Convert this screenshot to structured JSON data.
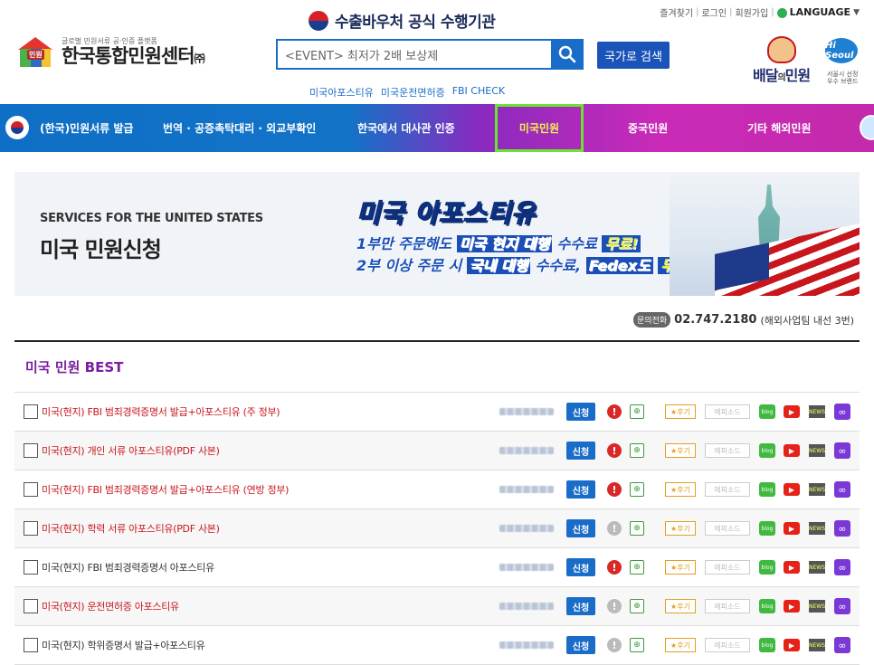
{
  "util": {
    "bookmark": "즐겨찾기",
    "login": "로그인",
    "signup": "회원가입",
    "language": "LANGUAGE"
  },
  "header": {
    "top_banner": "수출바우처 공식 수행기관",
    "logo_sub": "글로벌 민원서류 공·인증 플랫폼",
    "logo_main": "한국통합민원센터",
    "logo_suffix": "㈜",
    "logo_badge": "민원",
    "search_placeholder": "<EVENT> 최저가 2배 보상제",
    "country_search_label": "국가로 검색",
    "quick_links": [
      "미국아포스티유",
      "미국운전면허증",
      "FBI CHECK"
    ],
    "partner_title_a": "배달",
    "partner_title_b": "의",
    "partner_title_c": "민원",
    "partner_hi": "Hi Seoul",
    "partner_sub": "서울시 선정 우수 브랜드"
  },
  "nav": {
    "items": [
      "(한국)민원서류 발급",
      "번역 · 공증촉탁대리 · 외교부확인",
      "한국에서 대사관 인증",
      "미국민원",
      "중국민원",
      "기타 해외민원"
    ]
  },
  "hero": {
    "en_title": "SERVICES FOR THE UNITED STATES",
    "ko_title": "미국 민원신청",
    "apostille": "미국 아포스티유",
    "line1_a": "1부만 주문해도",
    "line1_b": "미국 현지 대행",
    "line1_c": "수수료",
    "line1_d": "무료!",
    "line2_a": "2부 이상 주문 시",
    "line2_b": "국내 대행",
    "line2_c": "수수료,",
    "line2_d": "Fedex도",
    "line2_e": "무료!"
  },
  "contact": {
    "tag": "문의전화",
    "phone": "02.747.2180",
    "ext": "(해외사업팀 내선 3번)"
  },
  "list": {
    "title": "미국 민원 BEST",
    "apply_label": "신청",
    "review_label": "★후기",
    "episode_label": "에피소드",
    "blog_label": "blog",
    "news_label": "NEWS",
    "rows": [
      {
        "name": "미국(현지) FBI 범죄경력증명서 발급+아포스티유 (주 정부)",
        "highlight": true,
        "alert": true
      },
      {
        "name": "미국(현지) 개인 서류 아포스티유(PDF 사본)",
        "highlight": true,
        "alert": true
      },
      {
        "name": "미국(현지) FBI 범죄경력증명서 발급+아포스티유 (연방 정부)",
        "highlight": true,
        "alert": true
      },
      {
        "name": "미국(현지) 학력 서류 아포스티유(PDF 사본)",
        "highlight": true,
        "alert": false
      },
      {
        "name": "미국(현지) FBI 범죄경력증명서 아포스티유",
        "highlight": false,
        "alert": true
      },
      {
        "name": "미국(현지) 운전면허증 아포스티유",
        "highlight": true,
        "alert": false
      },
      {
        "name": "미국(현지) 학위증명서 발급+아포스티유",
        "highlight": false,
        "alert": false
      }
    ]
  },
  "colors": {
    "nav_blue": "#1273c7",
    "nav_purple": "#c42aab",
    "highlight_border": "#6be331",
    "highlight_text": "#f5f24b",
    "best_title": "#7a1ea0",
    "row_red": "#c8161d",
    "apply_blue": "#1a6cc9"
  }
}
